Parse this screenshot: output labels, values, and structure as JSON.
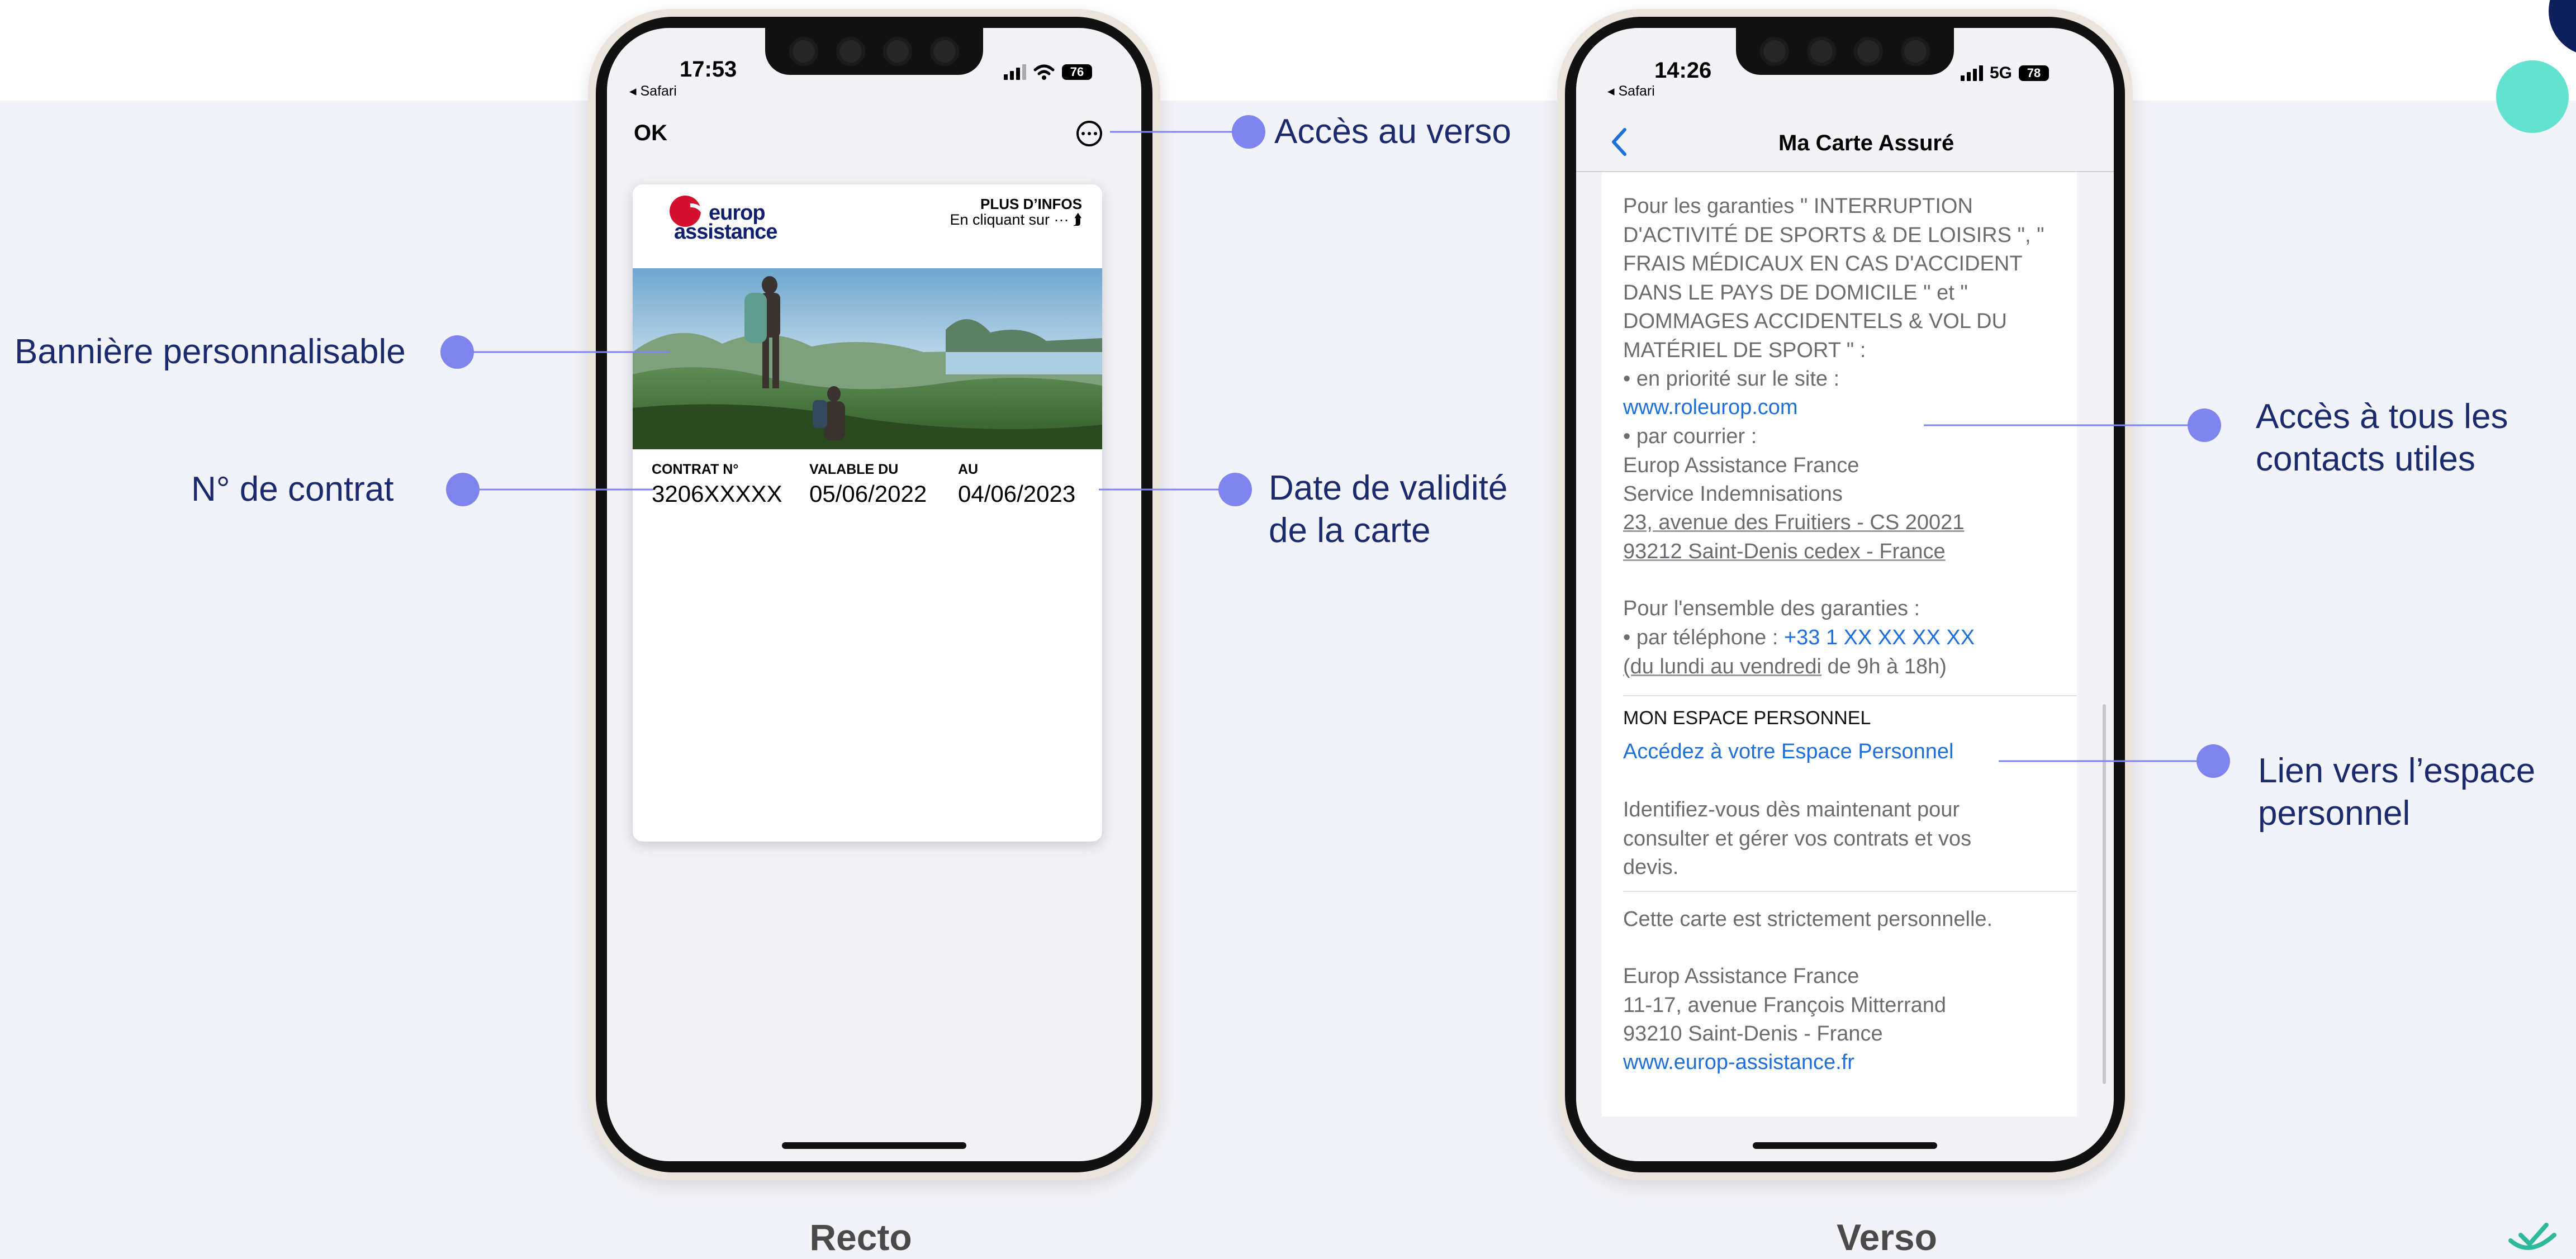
{
  "left_phone": {
    "status": {
      "time": "17:53",
      "back_app": "◂ Safari",
      "battery": "76"
    },
    "ok_label": "OK",
    "more_icon": "ellipsis-circle-icon",
    "card": {
      "logo_line1": "europ",
      "logo_line2": "assistance",
      "plus_title": "PLUS D’INFOS",
      "plus_sub": "En cliquant sur ··· ⮭",
      "fields": [
        {
          "label": "CONTRAT N°",
          "value": "3206XXXXX"
        },
        {
          "label": "VALABLE DU",
          "value": "05/06/2022"
        },
        {
          "label": "AU",
          "value": "04/06/2023"
        }
      ]
    }
  },
  "right_phone": {
    "status": {
      "time": "14:26",
      "back_app": "◂ Safari",
      "network": "5G",
      "battery": "78"
    },
    "nav_title": "Ma Carte Assuré",
    "block1": {
      "lines": [
        "Pour les garanties \" INTERRUPTION",
        "D'ACTIVITÉ DE SPORTS & DE LOISIRS \", \"",
        "FRAIS MÉDICAUX EN CAS D'ACCIDENT",
        "DANS LE PAYS DE DOMICILE \" et \"",
        "DOMMAGES ACCIDENTELS & VOL DU",
        "MATÉRIEL DE SPORT \" :",
        "• en priorité sur le site :"
      ],
      "site_link": "www.roleurop.com",
      "courier_lines": [
        "• par courrier :",
        "Europ Assistance France",
        "Service Indemnisations"
      ],
      "address_lines": [
        "23, avenue des Fruitiers - CS 20021",
        "93212 Saint-Denis cedex - France"
      ]
    },
    "block2": {
      "title_line": "Pour l'ensemble des garanties :",
      "phone_prefix": "• par téléphone : ",
      "phone_number": "+33 1 XX XX XX XX",
      "hours_underlined": "(du lundi au vendredi",
      "hours_rest": " de 9h à 18h)"
    },
    "section_title": "MON ESPACE PERSONNEL",
    "espace_link": "Accédez à votre Espace Personnel",
    "espace_desc": [
      "Identifiez-vous dès maintenant pour",
      "consulter et gérer vos contrats et vos",
      "devis."
    ],
    "personal_note": "Cette carte est strictement personnelle.",
    "company_lines": [
      "Europ Assistance France",
      "11-17, avenue François Mitterrand",
      "93210 Saint-Denis - France"
    ],
    "company_link": "www.europ-assistance.fr"
  },
  "annotations": {
    "acces_verso": "Accès au verso",
    "banniere": "Bannière personnalisable",
    "contrat": "N° de contrat",
    "validite": "Date de validité\nde la carte",
    "contacts": "Accès à tous les\ncontacts utiles",
    "espace": "Lien vers l’espace\npersonnel"
  },
  "captions": {
    "recto": "Recto",
    "verso": "Verso"
  },
  "colors": {
    "annotation_dot": "#7f84ee",
    "annotation_text": "#1a2a6c",
    "link": "#1e6fd9"
  }
}
